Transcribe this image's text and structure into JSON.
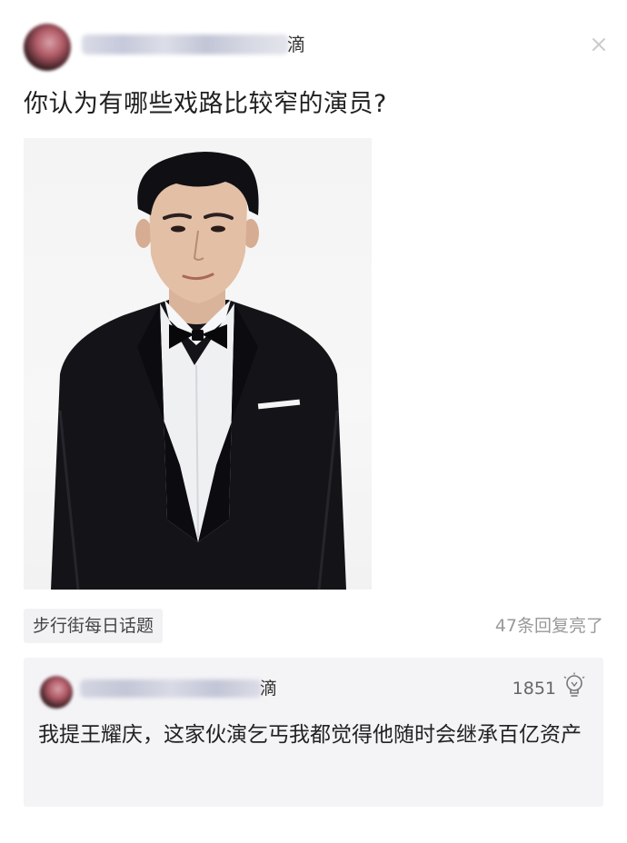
{
  "post": {
    "author_visible_suffix": "滴",
    "title": "你认为有哪些戏路比较窄的演员?",
    "topic_tag": "步行街每日话题",
    "reply_count": "47条回复亮了"
  },
  "top_comment": {
    "author_visible_suffix": "滴",
    "likes": "1851",
    "text": "我提王耀庆，这家伙演乞丐我都觉得他随时会继承百亿资产"
  },
  "icons": {
    "close": "close-icon",
    "like": "lightbulb-icon"
  },
  "colors": {
    "background": "#ffffff",
    "tag_bg": "#f2f2f5",
    "comment_bg": "#f4f4f7",
    "muted_text": "#999999",
    "suit": "#141418",
    "shirt": "#eef0f2"
  }
}
